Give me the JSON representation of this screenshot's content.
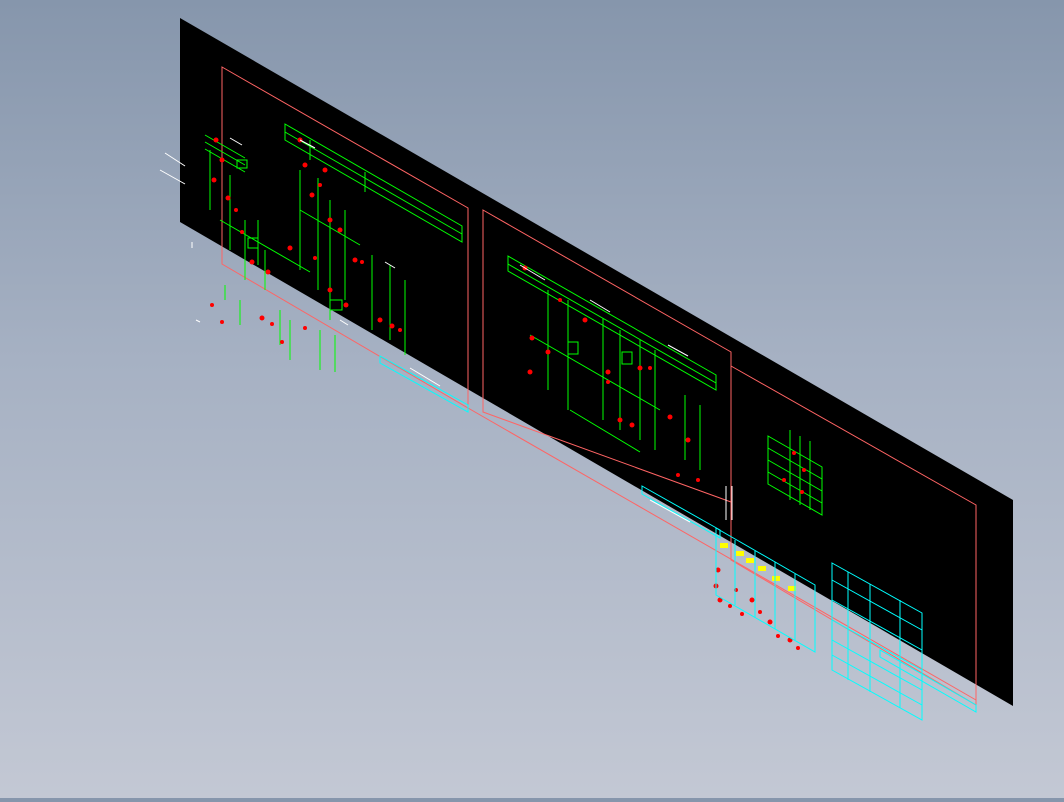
{
  "viewport": {
    "view": "isometric",
    "background_gradient": [
      "#8696ac",
      "#c3c8d4"
    ]
  },
  "drawing": {
    "sheet_color": "#000000",
    "frame_color": "#ff6464",
    "schematic_color": "#00ff00",
    "component_color": "#ff0000",
    "annotation_color": "#00ffff",
    "highlight_color": "#ffff00",
    "text_color": "#ffffff",
    "sheets": [
      {
        "frame": "frame-1"
      },
      {
        "frame": "frame-2"
      },
      {
        "frame": "frame-3"
      }
    ]
  }
}
